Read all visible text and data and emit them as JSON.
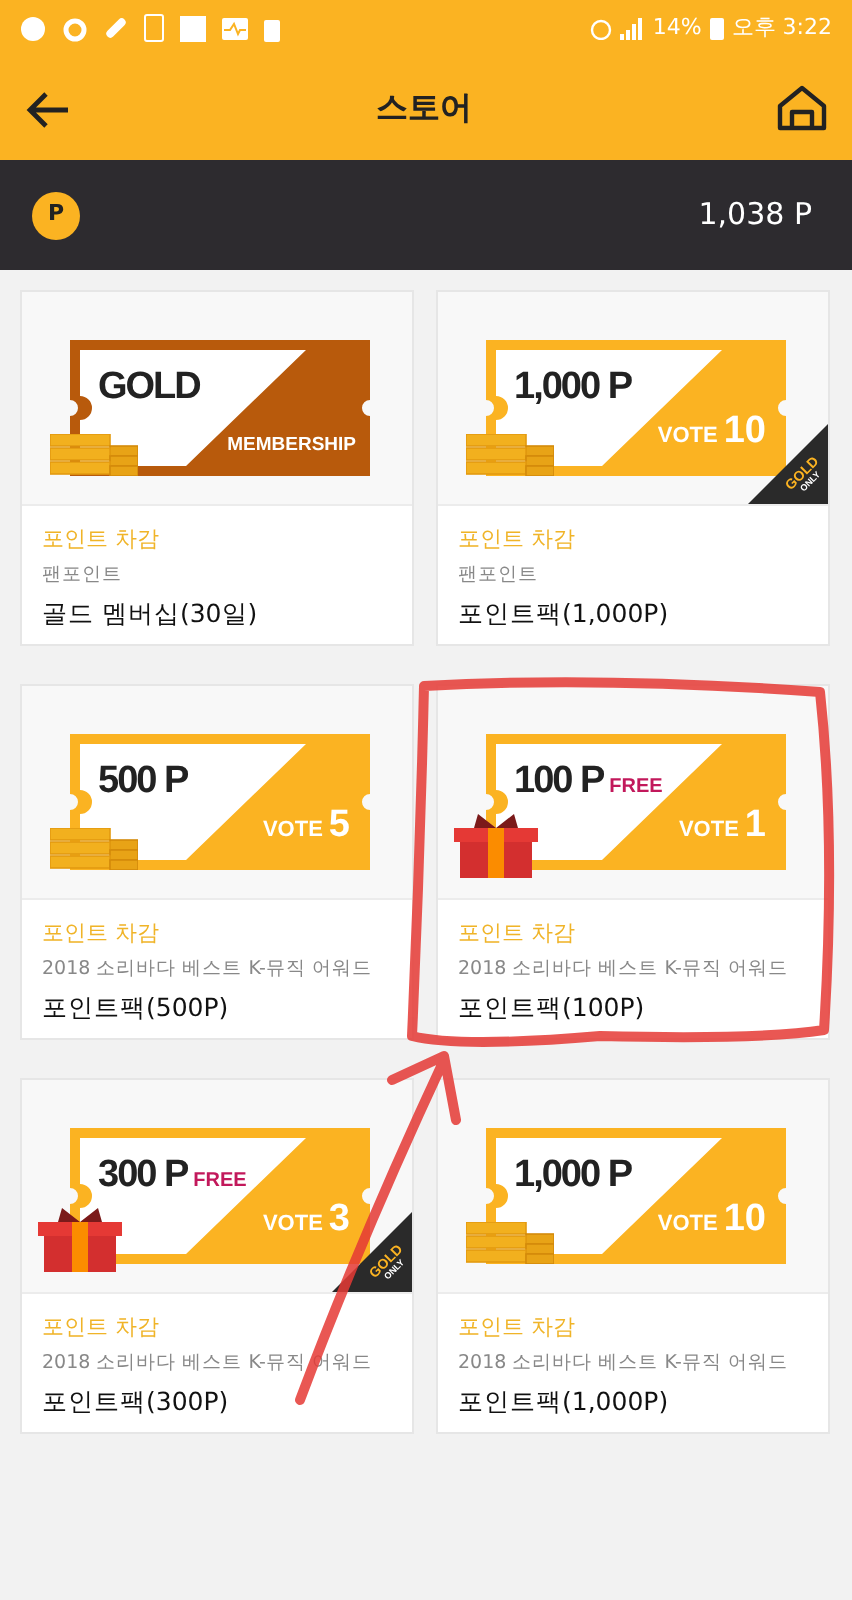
{
  "status_bar": {
    "battery": "14%",
    "time": "오후 3:22"
  },
  "header": {
    "title": "스토어"
  },
  "balance": {
    "badge": "P",
    "amount": "1,038 P"
  },
  "products": [
    {
      "kind": "coins",
      "ticket": {
        "kind": "membership",
        "title": "GOLD",
        "right_text": "MEMBERSHIP"
      },
      "gold_only": false,
      "label": "포인트 차감",
      "category": "팬포인트",
      "name": "골드 멤버십(30일)"
    },
    {
      "kind": "coins",
      "ticket": {
        "kind": "points",
        "title": "1,000 P",
        "vote_label": "VOTE",
        "vote_count": "10"
      },
      "gold_only": true,
      "gold_badge": [
        "GOLD",
        "ONLY"
      ],
      "label": "포인트 차감",
      "category": "팬포인트",
      "name": "포인트팩(1,000P)"
    },
    {
      "kind": "coins",
      "ticket": {
        "kind": "points",
        "title": "500 P",
        "vote_label": "VOTE",
        "vote_count": "5"
      },
      "gold_only": false,
      "label": "포인트 차감",
      "category": "2018 소리바다 베스트 K-뮤직 어워드",
      "name": "포인트팩(500P)"
    },
    {
      "kind": "gift",
      "ticket": {
        "kind": "points",
        "title": "100 P",
        "free": "FREE",
        "vote_label": "VOTE",
        "vote_count": "1"
      },
      "gold_only": false,
      "label": "포인트 차감",
      "category": "2018 소리바다 베스트 K-뮤직 어워드",
      "name": "포인트팩(100P)"
    },
    {
      "kind": "gift",
      "ticket": {
        "kind": "points",
        "title": "300 P",
        "free": "FREE",
        "vote_label": "VOTE",
        "vote_count": "3"
      },
      "gold_only": true,
      "gold_badge": [
        "GOLD",
        "ONLY"
      ],
      "label": "포인트 차감",
      "category": "2018 소리바다 베스트 K-뮤직 어워드",
      "name": "포인트팩(300P)"
    },
    {
      "kind": "coins",
      "ticket": {
        "kind": "points",
        "title": "1,000 P",
        "vote_label": "VOTE",
        "vote_count": "10"
      },
      "gold_only": false,
      "label": "포인트 차감",
      "category": "2018 소리바다 베스트 K-뮤직 어워드",
      "name": "포인트팩(1,000P)"
    }
  ]
}
